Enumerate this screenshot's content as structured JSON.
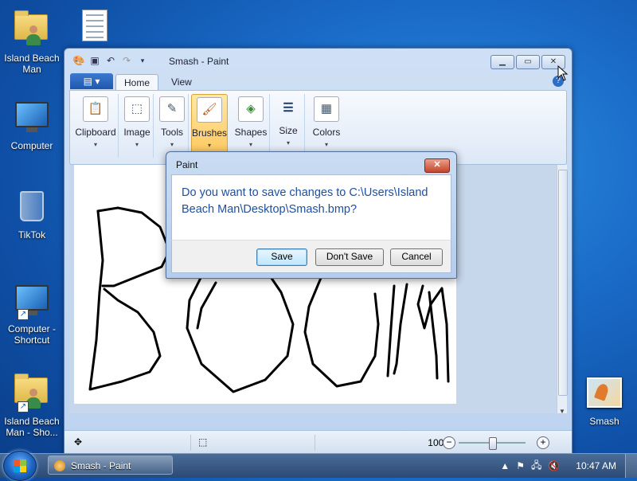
{
  "desktop": {
    "icons": [
      {
        "label": "Island Beach Man",
        "icon": "user-folder-icon"
      },
      {
        "label": "",
        "icon": "text-document-icon"
      },
      {
        "label": "Computer",
        "icon": "computer-icon"
      },
      {
        "label": "TikTok",
        "icon": "recycle-bin-icon"
      },
      {
        "label": "Computer - Shortcut",
        "icon": "computer-shortcut-icon"
      },
      {
        "label": "Island Beach Man - Sho...",
        "icon": "user-folder-shortcut-icon"
      },
      {
        "label": "Smash",
        "icon": "image-file-icon"
      }
    ]
  },
  "paint": {
    "window_title": "Smash - Paint",
    "tabs": [
      "Home",
      "View"
    ],
    "ribbon_groups": [
      "Clipboard",
      "Image",
      "Tools",
      "Brushes",
      "Shapes",
      "Size",
      "Colors"
    ],
    "active_group": "Brushes",
    "zoom": "100%",
    "zoom_out": "−",
    "zoom_in": "+",
    "help": "?"
  },
  "dialog": {
    "title": "Paint",
    "close_glyph": "✕",
    "message": "Do you want to save changes to C:\\Users\\Island Beach Man\\Desktop\\Smash.bmp?",
    "buttons": {
      "save": "Save",
      "dont_save": "Don't Save",
      "cancel": "Cancel"
    }
  },
  "taskbar": {
    "items": [
      {
        "label": "Smash - Paint"
      }
    ],
    "clock": "10:47 AM"
  }
}
